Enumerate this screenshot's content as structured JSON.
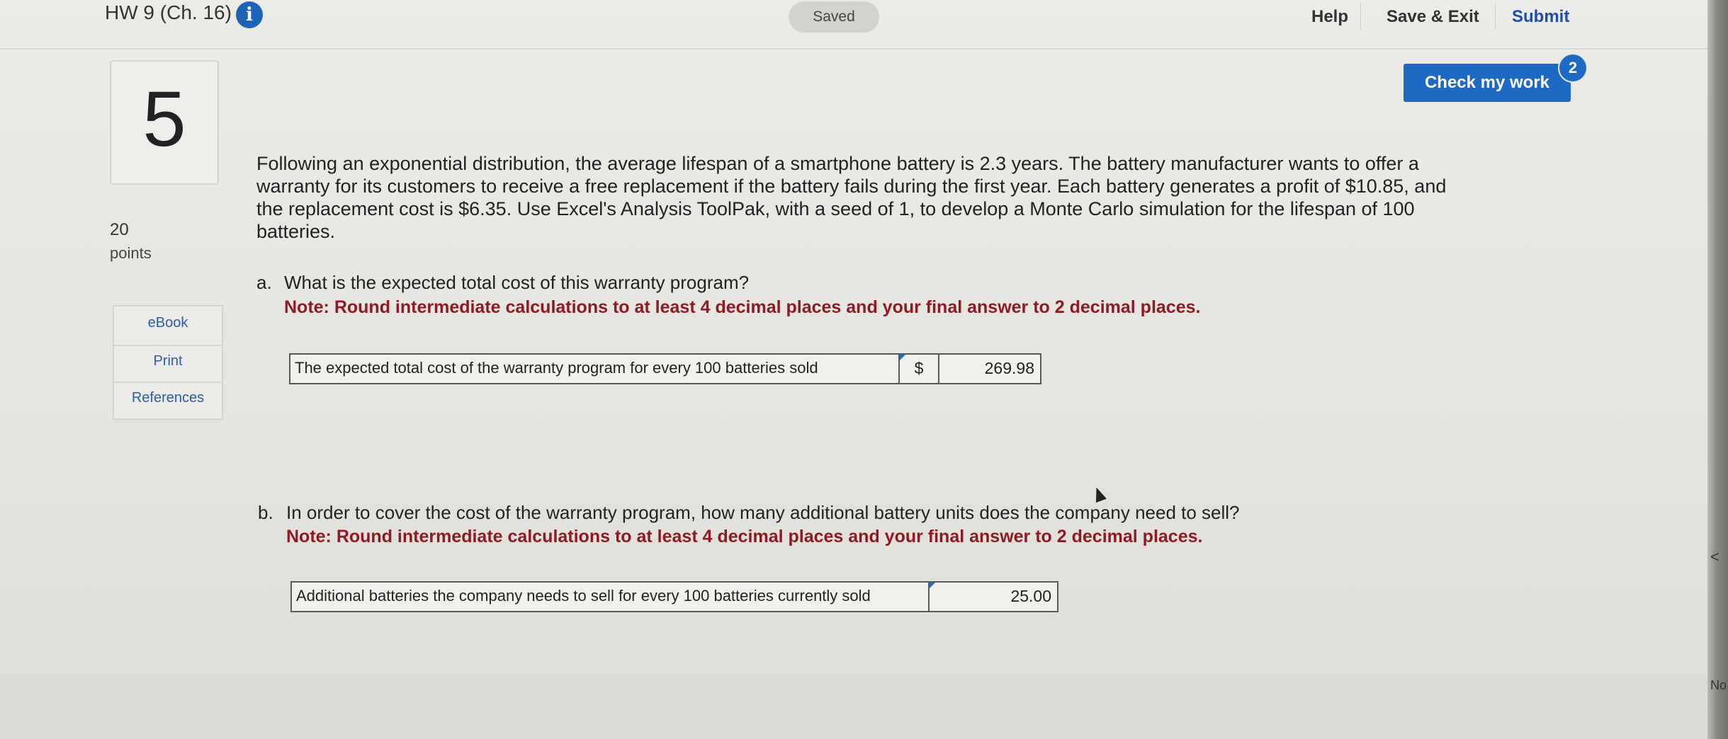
{
  "header": {
    "assignment_title": "HW 9 (Ch. 16)",
    "info_icon": "info-icon",
    "status": "Saved",
    "help_label": "Help",
    "save_exit_label": "Save & Exit",
    "submit_label": "Submit"
  },
  "question": {
    "number": "5",
    "points": "20",
    "points_label": "points",
    "resources": [
      "eBook",
      "Print",
      "References"
    ],
    "stem": "Following an exponential distribution, the average lifespan of a smartphone battery is 2.3 years. The battery manufacturer wants to offer a warranty for its customers to receive a free replacement if the battery fails during the first year. Each battery generates a profit of $10.85, and the replacement cost is $6.35. Use Excel's Analysis ToolPak, with a seed of 1, to develop a Monte Carlo simulation for the lifespan of 100 batteries."
  },
  "check_my_work": {
    "label": "Check my work",
    "badge": "2"
  },
  "part_a": {
    "letter": "a.",
    "question": "What is the expected total cost of this warranty program?",
    "note": "Note: Round intermediate calculations to at least 4 decimal places and your final answer to 2 decimal places.",
    "row_label": "The expected total cost of the warranty program for every 100 batteries sold",
    "currency": "$",
    "value": "269.98"
  },
  "part_b": {
    "letter": "b.",
    "question": "In order to cover the cost of the warranty program, how many additional battery units does the company need to sell?",
    "note": "Note: Round intermediate calculations to at least 4 decimal places and your final answer to 2 decimal places.",
    "row_label": "Additional batteries the company needs to sell for every 100 batteries currently sold",
    "value": "25.00"
  },
  "side_strip": {
    "chevron": "<",
    "text": "No"
  },
  "colors": {
    "primary_blue": "#1e69c3",
    "note_red": "#8e1b24",
    "link_blue": "#2a5ea5"
  }
}
